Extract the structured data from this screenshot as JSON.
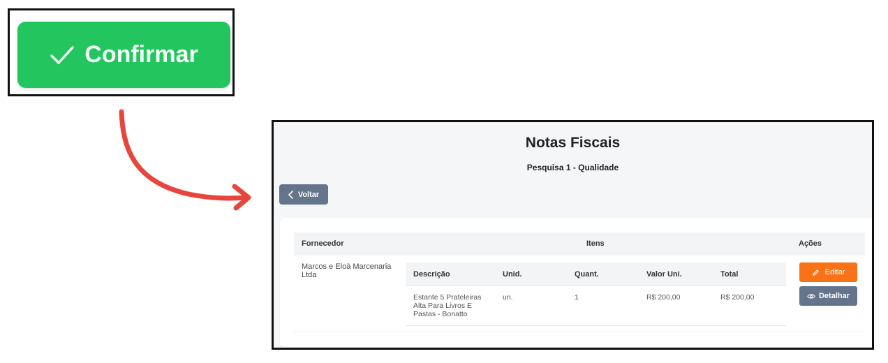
{
  "confirm": {
    "label": "Confirmar",
    "color": "#22c55e"
  },
  "page": {
    "title": "Notas Fiscais",
    "subtitle": "Pesquisa 1 - Qualidade"
  },
  "back_button": {
    "label": "Voltar"
  },
  "table": {
    "headers": {
      "supplier": "Fornecedor",
      "items": "Itens",
      "actions": "Ações"
    },
    "rows": [
      {
        "supplier": "Marcos e Eloà Marcenaria Ltda",
        "items_headers": {
          "description": "Descrição",
          "unit": "Unid.",
          "quantity": "Quant.",
          "unit_value": "Valor Uni.",
          "total": "Total"
        },
        "items": [
          {
            "description": "Estante 5 Prateleiras Alta Para Livros E Pastas - Bonatto",
            "unit": "un.",
            "quantity": "1",
            "unit_value": "R$ 200,00",
            "total": "R$ 200,00"
          }
        ],
        "actions": {
          "edit": "Editar",
          "detail": "Detalhar"
        }
      }
    ]
  },
  "colors": {
    "edit": "#f97316",
    "neutral": "#64748b",
    "arrow": "#e8453c"
  }
}
